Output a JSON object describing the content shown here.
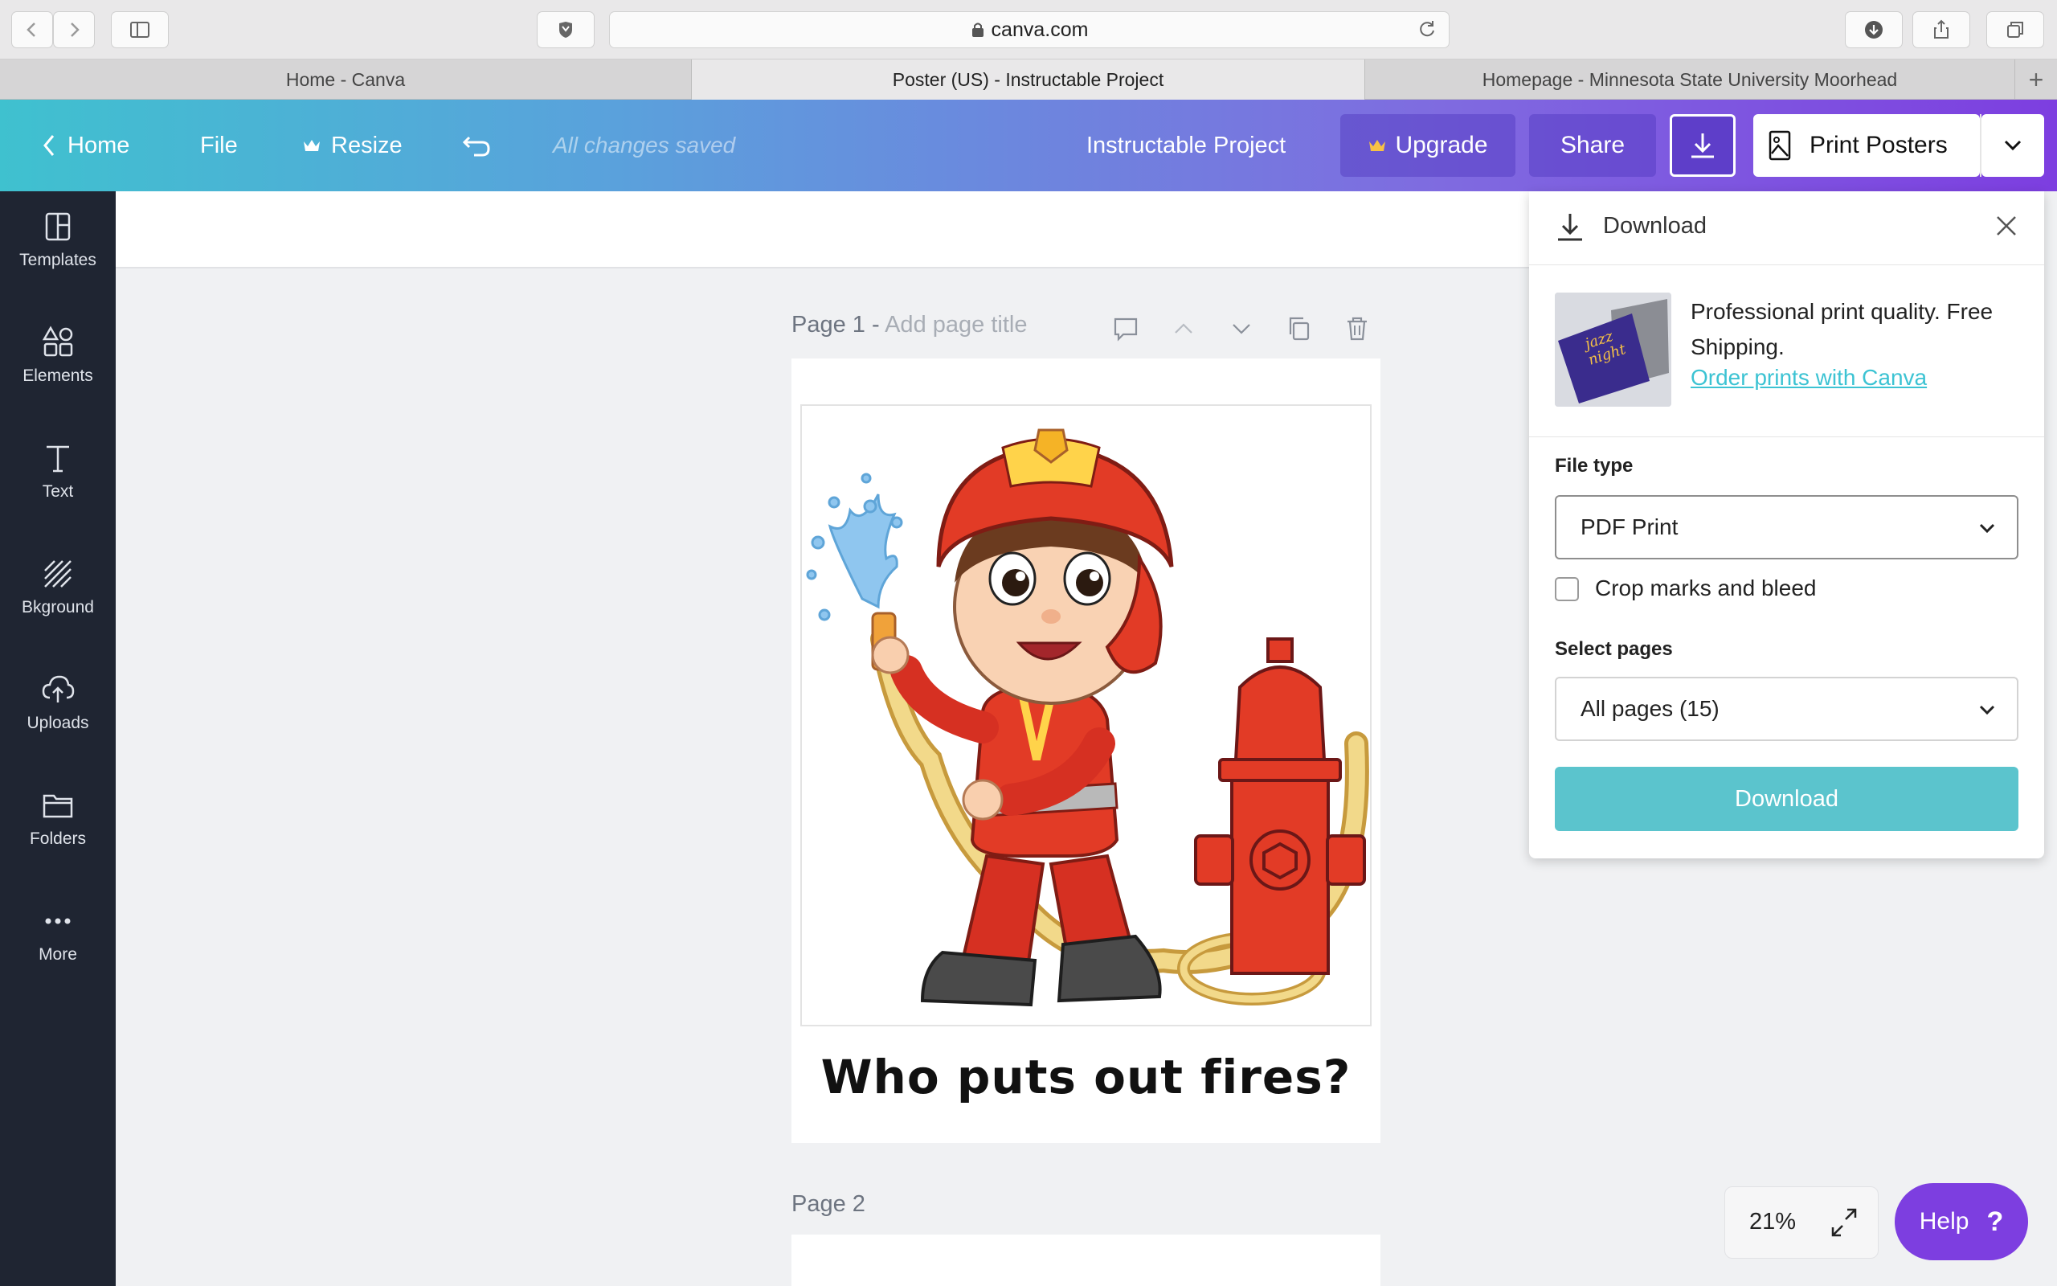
{
  "browser": {
    "url": "canva.com",
    "tabs": [
      {
        "label": "Home - Canva"
      },
      {
        "label": "Poster (US) - Instructable Project"
      },
      {
        "label": "Homepage - Minnesota State University Moorhead"
      }
    ],
    "new_tab_symbol": "+"
  },
  "header": {
    "home_label": "Home",
    "file_label": "File",
    "resize_label": "Resize",
    "saved_status": "All changes saved",
    "project_title": "Instructable Project",
    "upgrade_label": "Upgrade",
    "share_label": "Share",
    "print_label": "Print Posters"
  },
  "sidebar": {
    "items": [
      {
        "label": "Templates",
        "icon": "templates-icon"
      },
      {
        "label": "Elements",
        "icon": "elements-icon"
      },
      {
        "label": "Text",
        "icon": "text-icon"
      },
      {
        "label": "Bkground",
        "icon": "background-icon"
      },
      {
        "label": "Uploads",
        "icon": "uploads-icon"
      },
      {
        "label": "Folders",
        "icon": "folders-icon"
      },
      {
        "label": "More",
        "icon": "more-icon"
      }
    ]
  },
  "canvas": {
    "page1_prefix": "Page 1 - ",
    "page1_title_placeholder": "Add page title",
    "caption": "Who puts out fires?",
    "page2_label": "Page 2"
  },
  "download_panel": {
    "title": "Download",
    "promo_text": "Professional print quality. Free Shipping.",
    "promo_link": "Order prints with Canva",
    "promo_image_text": [
      "jazz",
      "night"
    ],
    "file_type_label": "File type",
    "file_type_value": "PDF Print",
    "crop_label": "Crop marks and bleed",
    "select_pages_label": "Select pages",
    "select_pages_value": "All pages (15)",
    "download_button": "Download"
  },
  "zoom": {
    "value": "21%"
  },
  "help": {
    "label": "Help",
    "symbol": "?"
  },
  "colors": {
    "accent_teal": "#5bc4cd",
    "accent_purple": "#7d3ee0",
    "sidebar_bg": "#1f2532"
  }
}
